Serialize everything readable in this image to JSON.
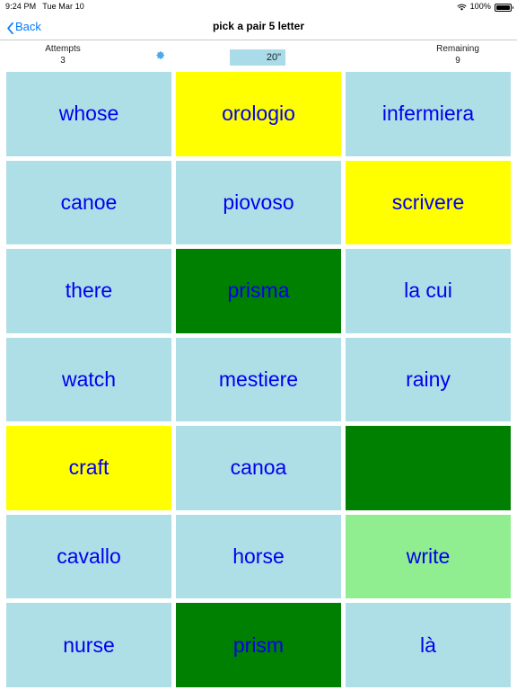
{
  "status_bar": {
    "time": "9:24 PM",
    "date": "Tue Mar 10",
    "wifi_icon": "wifi-icon",
    "battery_percent": "100%",
    "battery_icon": "battery-icon"
  },
  "nav_bar": {
    "back_label": "Back",
    "back_icon": "chevron-left-icon",
    "title": "pick a pair 5 letter"
  },
  "stats": {
    "attempts_label": "Attempts",
    "attempts_value": "3",
    "settings_icon": "gear-icon",
    "timer_value": "20\"",
    "remaining_label": "Remaining",
    "remaining_value": "9"
  },
  "colors": {
    "tile_default": "#aedfe7",
    "tile_selected": "#ffff00",
    "tile_matched": "#008000",
    "tile_hint": "#90ee90",
    "tile_text": "#0000ee",
    "accent": "#007aff",
    "timer_background": "#a9dbe8"
  },
  "grid": {
    "columns": 3,
    "rows": 7,
    "tiles": [
      {
        "label": "whose",
        "state": "default"
      },
      {
        "label": "orologio",
        "state": "selected"
      },
      {
        "label": "infermiera",
        "state": "default"
      },
      {
        "label": "canoe",
        "state": "default"
      },
      {
        "label": "piovoso",
        "state": "default"
      },
      {
        "label": "scrivere",
        "state": "selected"
      },
      {
        "label": "there",
        "state": "default"
      },
      {
        "label": "prisma",
        "state": "matched"
      },
      {
        "label": "la cui",
        "state": "default"
      },
      {
        "label": "watch",
        "state": "default"
      },
      {
        "label": "mestiere",
        "state": "default"
      },
      {
        "label": "rainy",
        "state": "default"
      },
      {
        "label": "craft",
        "state": "selected"
      },
      {
        "label": "canoa",
        "state": "default"
      },
      {
        "label": "",
        "state": "matched"
      },
      {
        "label": "cavallo",
        "state": "default"
      },
      {
        "label": "horse",
        "state": "default"
      },
      {
        "label": "write",
        "state": "hint"
      },
      {
        "label": "nurse",
        "state": "default"
      },
      {
        "label": "prism",
        "state": "matched"
      },
      {
        "label": "là",
        "state": "default"
      }
    ]
  }
}
